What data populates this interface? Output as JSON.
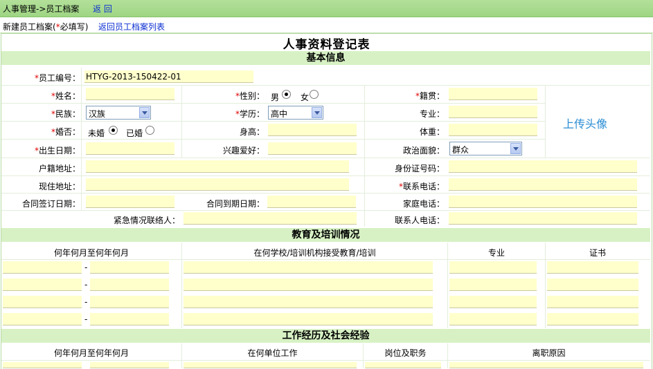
{
  "breadcrumb": "人事管理->员工档案",
  "back_label": "返 回",
  "subbar": {
    "title": "新建员工档案(",
    "required_mark": "*",
    "title_end": "必填写)",
    "list_link": "返回员工档案列表"
  },
  "form_title": "人事资料登记表",
  "sections": {
    "basic": "基本信息",
    "education": "教育及培训情况",
    "work": "工作经历及社会经验"
  },
  "basic": {
    "employee_no_label": "员工编号：",
    "employee_no": "HTYG-2013-150422-01",
    "name_label": "姓名：",
    "gender_label": "性别：",
    "gender_male": "男",
    "gender_female": "女",
    "native_label": "籍贯：",
    "ethnic_label": "民族：",
    "ethnic_value": "汉族",
    "education_label": "学历：",
    "education_value": "高中",
    "major_label": "专业：",
    "marital_label": "婚否：",
    "marital_no": "未婚",
    "marital_yes": "已婚",
    "height_label": "身高：",
    "weight_label": "体重：",
    "birth_label": "出生日期：",
    "hobby_label": "兴趣爱好：",
    "political_label": "政治面貌：",
    "political_value": "群众",
    "hukou_label": "户籍地址：",
    "id_label": "身份证号码：",
    "address_label": "现住地址：",
    "phone_label": "联系电话：",
    "contract_sign_label": "合同签订日期：",
    "contract_end_label": "合同到期日期：",
    "home_phone_label": "家庭电话：",
    "emergency_label": "紧急情况联络人：",
    "contact_phone_label": "联系人电话：",
    "upload_label": "上传头像"
  },
  "education_cols": {
    "period": "何年何月至何年何月",
    "school": "在何学校/培训机构接受教育/培训",
    "major": "专业",
    "cert": "证书"
  },
  "work_cols": {
    "period": "何年何月至何年何月",
    "company": "在何单位工作",
    "position": "岗位及职务",
    "reason": "离职原因"
  },
  "dash": "-"
}
